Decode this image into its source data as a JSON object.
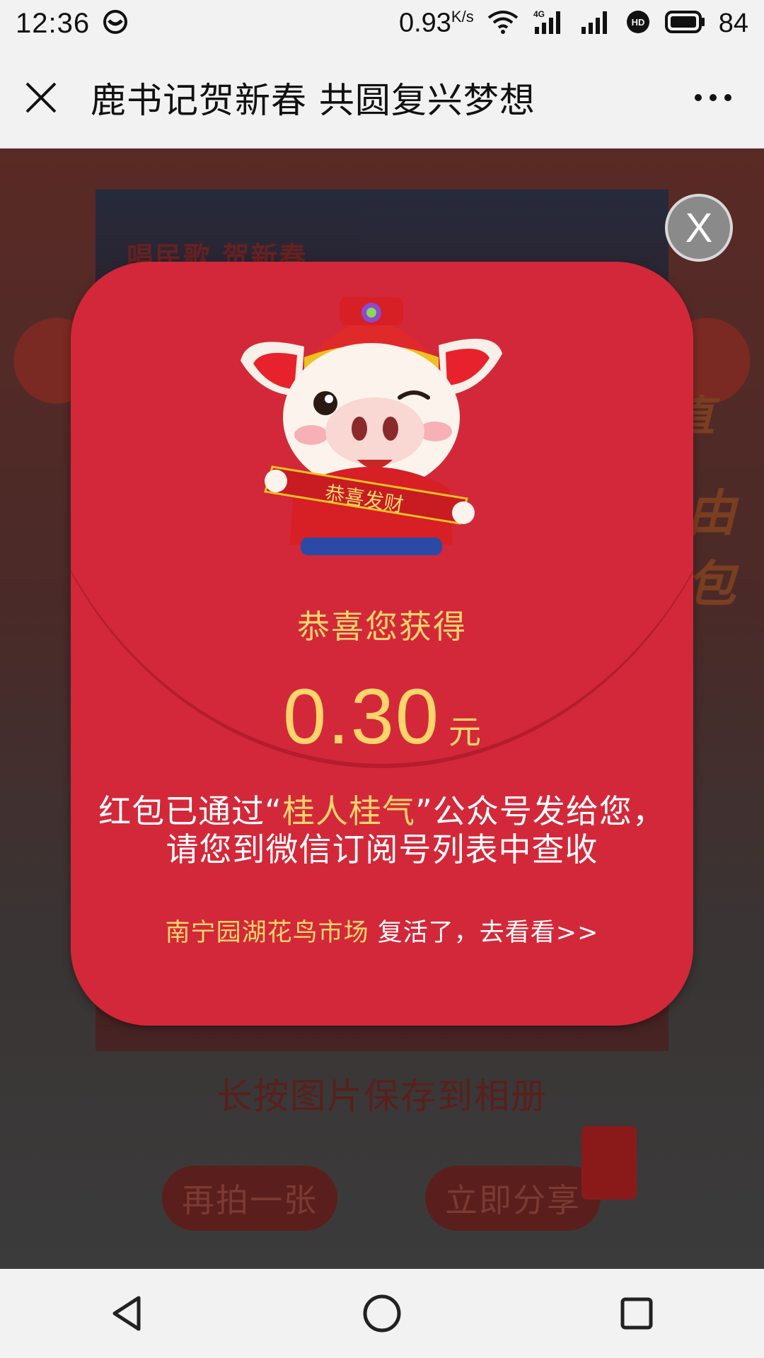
{
  "status_bar": {
    "time": "12:36",
    "net_speed": "0.93",
    "net_speed_unit": "K/s",
    "battery": "84",
    "network_label": "4G",
    "hd_label": "HD"
  },
  "top_bar": {
    "title": "鹿书记贺新春 共圆复兴梦想"
  },
  "background": {
    "card_top_text": "唱民歌 贺新春",
    "right_deco_1": "直",
    "right_deco_2": "由",
    "right_deco_3": "包",
    "save_hint": "长按图片保存到相册",
    "retake_button": "再拍一张",
    "share_button": "立即分享"
  },
  "modal": {
    "pig_banner": "恭喜发财",
    "congrats": "恭喜您获得",
    "amount": "0.30",
    "unit": "元",
    "message_part1": "红包已通过“",
    "message_highlight": "桂人桂气",
    "message_part2": "”公众号发给您，",
    "message_line2": "请您到微信订阅号列表中查收",
    "revive_place": "南宁园湖花鸟市场",
    "revive_action": " 复活了，去看看>>",
    "close_label": "X"
  },
  "colors": {
    "modal_bg": "#d32839",
    "accent_gold": "#ffd46b"
  }
}
